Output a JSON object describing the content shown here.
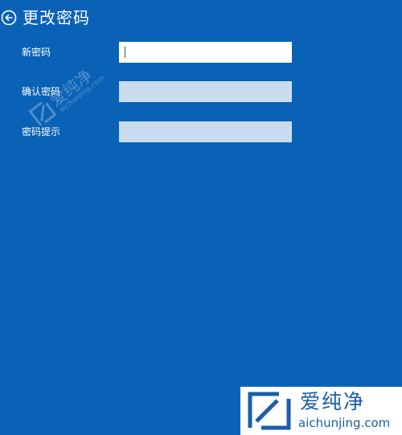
{
  "header": {
    "title": "更改密码",
    "back_icon": "back-arrow-icon"
  },
  "form": {
    "fields": [
      {
        "label": "新密码",
        "value": "",
        "active": true
      },
      {
        "label": "确认密码",
        "value": "",
        "active": false
      },
      {
        "label": "密码提示",
        "value": "",
        "active": false
      }
    ]
  },
  "watermark": {
    "brand": "爱纯净",
    "url": "aichunjing.com"
  },
  "colors": {
    "background": "#0a62b6",
    "input_inactive": "#c9dcef",
    "input_active": "#ffffff",
    "logo_text": "#1a5fa8"
  }
}
